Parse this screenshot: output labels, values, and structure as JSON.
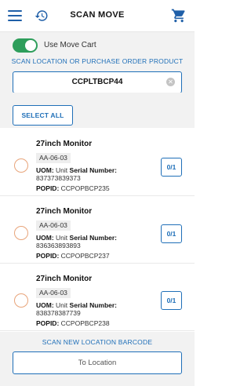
{
  "header": {
    "title": "SCAN MOVE",
    "menu_icon": "hamburger-menu-icon",
    "history_icon": "history-icon",
    "cart_icon": "shopping-cart-icon"
  },
  "move_cart": {
    "label": "Use Move Cart",
    "enabled": true
  },
  "scan": {
    "caption": "SCAN LOCATION OR PURCHASE ORDER PRODUCT",
    "value": "CCPLTBCP44"
  },
  "select_all_label": "SELECT ALL",
  "items": [
    {
      "name": "27inch Monitor",
      "location": "AA-06-03",
      "uom_label": "UOM:",
      "uom": "Unit",
      "serial_label": "Serial Number:",
      "serial": "837373839373",
      "popid_label": "POPID:",
      "popid": "CCPOPBCP235",
      "qty": "0/1"
    },
    {
      "name": "27inch Monitor",
      "location": "AA-06-03",
      "uom_label": "UOM:",
      "uom": "Unit",
      "serial_label": "Serial Number:",
      "serial": "836363893893",
      "popid_label": "POPID:",
      "popid": "CCPOPBCP237",
      "qty": "0/1"
    },
    {
      "name": "27inch Monitor",
      "location": "AA-06-03",
      "uom_label": "UOM:",
      "uom": "Unit",
      "serial_label": "Serial Number:",
      "serial": "838378387739",
      "popid_label": "POPID:",
      "popid": "CCPOPBCP238",
      "qty": "0/1"
    }
  ],
  "bottom": {
    "caption": "SCAN NEW LOCATION BARCODE",
    "to_location_placeholder": "To Location"
  },
  "colors": {
    "accent": "#1f6fb8",
    "toggle_on": "#2e9e5b",
    "radio_border": "#e8a47a"
  }
}
